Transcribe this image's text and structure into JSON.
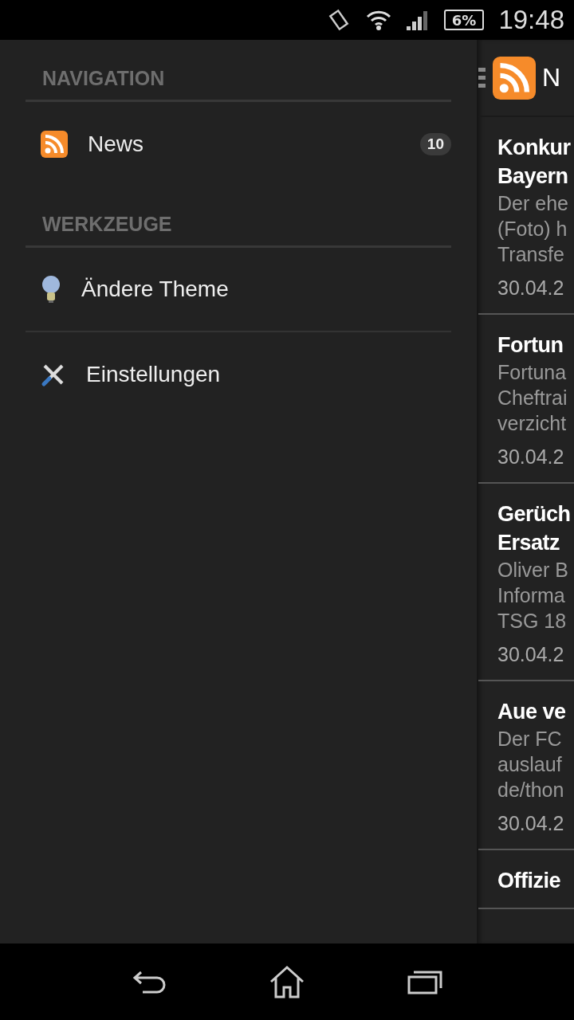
{
  "status_bar": {
    "battery": "6%",
    "time": "19:48"
  },
  "drawer": {
    "sections": [
      {
        "title": "NAVIGATION",
        "items": [
          {
            "label": "News",
            "badge": "10"
          }
        ]
      },
      {
        "title": "WERKZEUGE",
        "items": [
          {
            "label": "Ändere Theme"
          },
          {
            "label": "Einstellungen"
          }
        ]
      }
    ]
  },
  "feed": {
    "title": "N",
    "articles": [
      {
        "title": [
          "Konkur",
          "Bayern"
        ],
        "summary": [
          "Der ehe",
          "(Foto) h",
          "Transfe"
        ],
        "date": "30.04.2"
      },
      {
        "title": [
          "Fortun"
        ],
        "summary": [
          "Fortuna",
          "Cheftrai",
          "verzicht"
        ],
        "date": "30.04.2"
      },
      {
        "title": [
          "Gerüch",
          "Ersatz"
        ],
        "summary": [
          "Oliver B",
          "Informa",
          "TSG 18"
        ],
        "date": "30.04.2"
      },
      {
        "title": [
          "Aue ve"
        ],
        "summary": [
          "Der FC",
          "auslauf",
          "de/thon"
        ],
        "date": "30.04.2"
      },
      {
        "title": [
          "Offizie"
        ]
      }
    ]
  }
}
